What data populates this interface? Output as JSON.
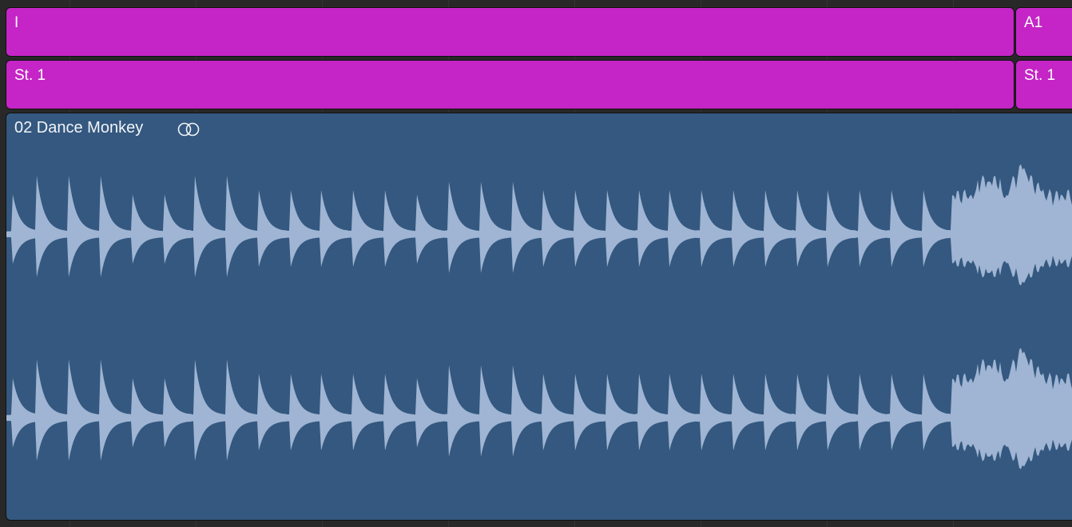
{
  "tracks": {
    "arrangement_lane": {
      "regions": [
        {
          "label": "I"
        },
        {
          "label": "A1"
        }
      ]
    },
    "chord_lane": {
      "regions": [
        {
          "label": "St. 1"
        },
        {
          "label": "St. 1"
        }
      ]
    },
    "audio_region": {
      "title": "02 Dance Monkey",
      "icon": "stereo-link-icon"
    }
  },
  "colors": {
    "background": "#282828",
    "magenta_region": "#c525c6",
    "audio_region": "#34587f",
    "waveform": "#9fb5d3"
  }
}
